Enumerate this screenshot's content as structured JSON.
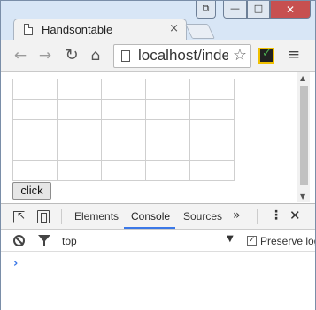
{
  "window": {
    "controls": {
      "minimize": "—",
      "maximize": "□",
      "close": "✕",
      "profile": "⧉"
    }
  },
  "tab": {
    "title": "Handsontable",
    "close": "×"
  },
  "toolbar": {
    "back": "←",
    "forward": "→",
    "reload": "↻",
    "home": "⌂",
    "url": "localhost/index",
    "star": "☆",
    "menu": "≡"
  },
  "page": {
    "grid": {
      "rows": 5,
      "cols": 5
    },
    "button_label": "click"
  },
  "devtools": {
    "tabs": [
      "Elements",
      "Console",
      "Sources"
    ],
    "active_tab": "Console",
    "more": "»",
    "kebab": "⋮",
    "close": "✕",
    "context": "top",
    "context_caret": "▼",
    "preserve_log_label": "Preserve log",
    "preserve_log_checked": true,
    "checkbox_mark": "✓",
    "prompt": "›"
  },
  "colors": {
    "accent": "#3b78e7",
    "titlebar": "#d8e6f6",
    "close_button": "#c75050"
  }
}
